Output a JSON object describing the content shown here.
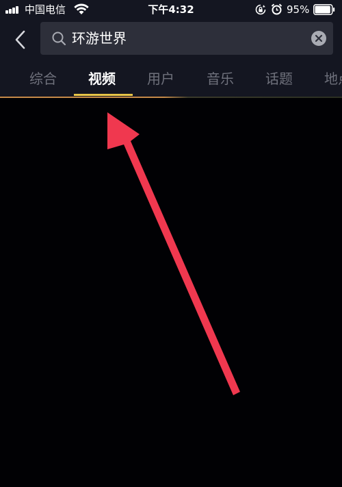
{
  "status_bar": {
    "carrier": "中国电信",
    "time": "下午4:32",
    "battery_percent": "95%",
    "battery_level": 0.95,
    "icons": [
      "signal-icon",
      "wifi-icon",
      "rotation-lock-icon",
      "alarm-icon",
      "battery-icon"
    ]
  },
  "header": {
    "back_icon": "chevron-left-icon",
    "search_icon": "search-icon",
    "search_value": "环游世界",
    "clear_icon": "clear-icon"
  },
  "tabs": {
    "items": [
      {
        "label": "综合",
        "active": false
      },
      {
        "label": "视频",
        "active": true
      },
      {
        "label": "用户",
        "active": false
      },
      {
        "label": "音乐",
        "active": false
      },
      {
        "label": "话题",
        "active": false
      },
      {
        "label": "地点",
        "active": false
      }
    ],
    "active_color": "#ffffff",
    "inactive_color": "#6f717c",
    "indicator_color": "#e8c547"
  },
  "annotation": {
    "type": "arrow",
    "color": "#f0384f",
    "points_to": "视频"
  },
  "colors": {
    "background": "#010104",
    "header_background": "#141621",
    "search_background": "#2d2f3a"
  }
}
